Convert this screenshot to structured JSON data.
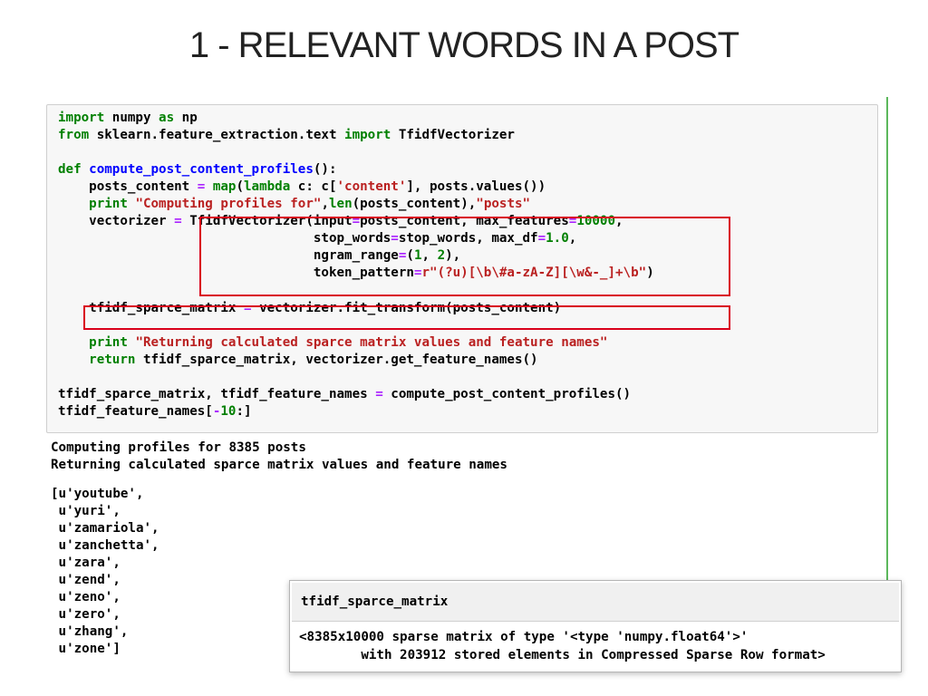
{
  "slide": {
    "title": "1 - RELEVANT WORDS IN A POST"
  },
  "colors": {
    "keyword": "#008000",
    "function_name": "#0000ff",
    "string": "#ba2121",
    "number": "#008000",
    "operator": "#aa22ff",
    "highlight_box": "#d9001b",
    "cell_border": "#5cb85c"
  },
  "code": {
    "l1": {
      "k1": "import",
      "t1": " numpy ",
      "k2": "as",
      "t2": " np"
    },
    "l2": {
      "k1": "from",
      "t1": " sklearn.feature_extraction.text ",
      "k2": "import",
      "t2": " TfidfVectorizer"
    },
    "l3": {
      "k1": "def",
      "t1": " ",
      "fn": "compute_post_content_profiles",
      "t2": "():"
    },
    "l4": {
      "t1": "    posts_content ",
      "o1": "=",
      "t2": " ",
      "b1": "map",
      "t3": "(",
      "k1": "lambda",
      "t4": " c: c[",
      "s1": "'content'",
      "t5": "], posts.values())"
    },
    "l5": {
      "t1": "    ",
      "k1": "print",
      "t2": " ",
      "s1": "\"Computing profiles for\"",
      "t3": ",",
      "b1": "len",
      "t4": "(posts_content),",
      "s2": "\"posts\""
    },
    "l6": {
      "t1": "    vectorizer ",
      "o1": "=",
      "t2": " TfidfVectorizer(input",
      "o2": "=",
      "t3": "posts_content, max_features",
      "o3": "=",
      "n1": "10000",
      "t4": ","
    },
    "l7": {
      "t1": "                                 stop_words",
      "o1": "=",
      "t2": "stop_words, max_df",
      "o2": "=",
      "n1": "1.0",
      "t3": ","
    },
    "l8": {
      "t1": "                                 ngram_range",
      "o1": "=",
      "t2": "(",
      "n1": "1",
      "t3": ", ",
      "n2": "2",
      "t4": "),"
    },
    "l9": {
      "t1": "                                 token_pattern",
      "o1": "=",
      "s1": "r\"(?u)[\\b\\#a-zA-Z][\\w&-_]+\\b\"",
      "t2": ")"
    },
    "l10": {
      "t1": "    tfidf_sparce_matrix ",
      "o1": "=",
      "t2": " vectorizer.fit_transform(posts_content)"
    },
    "l11": {
      "t1": "    ",
      "k1": "print",
      "t2": " ",
      "s1": "\"Returning calculated sparce matrix values and feature names\""
    },
    "l12": {
      "t1": "    ",
      "k1": "return",
      "t2": " tfidf_sparce_matrix, vectorizer.get_feature_names()"
    },
    "l13": {
      "t1": "tfidf_sparce_matrix, tfidf_feature_names ",
      "o1": "=",
      "t2": " compute_post_content_profiles()"
    },
    "l14": {
      "t1": "tfidf_feature_names[",
      "o1": "-",
      "n1": "10",
      "t2": ":]"
    }
  },
  "output": {
    "lines": [
      "Computing profiles for 8385 posts",
      "Returning calculated sparce matrix values and feature names",
      "[u'youtube',",
      " u'yuri',",
      " u'zamariola',",
      " u'zanchetta',",
      " u'zara',",
      " u'zend',",
      " u'zeno',",
      " u'zero',",
      " u'zhang',",
      " u'zone']"
    ]
  },
  "popup": {
    "title": "tfidf_sparce_matrix",
    "line1": "<8385x10000 sparse matrix of type '<type 'numpy.float64'>'",
    "line2": "        with 203912 stored elements in Compressed Sparse Row format>"
  }
}
